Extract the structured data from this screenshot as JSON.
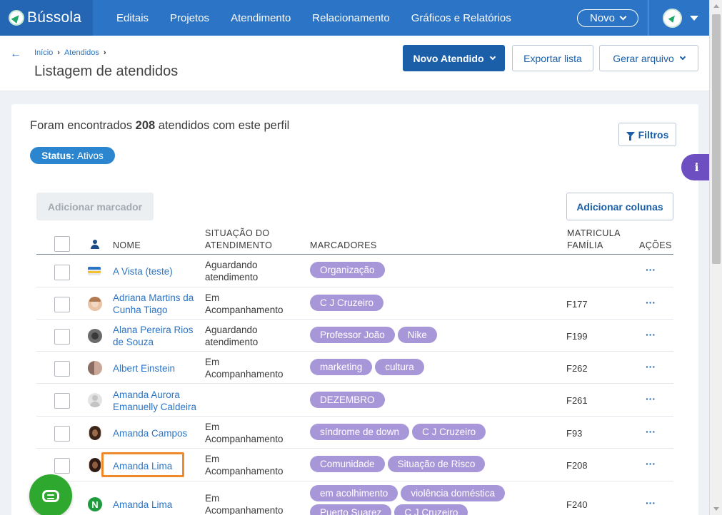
{
  "app": {
    "logo_text": "Bússola"
  },
  "nav": {
    "items": [
      "Editais",
      "Projetos",
      "Atendimento",
      "Relacionamento",
      "Gráficos e Relatórios"
    ],
    "novo_label": "Novo"
  },
  "header": {
    "breadcrumb": [
      "Início",
      "Atendidos"
    ],
    "title": "Listagem de atendidos",
    "btn_novo_atendido": "Novo Atendido",
    "btn_exportar": "Exportar lista",
    "btn_gerar": "Gerar arquivo"
  },
  "summary": {
    "prefix": "Foram encontrados",
    "count": "208",
    "suffix": "atendidos com este perfil"
  },
  "filters": {
    "btn_label": "Filtros",
    "status_key": "Status:",
    "status_value": "Ativos"
  },
  "info_label": "i",
  "actions": {
    "add_marker": "Adicionar marcador",
    "add_columns": "Adicionar colunas"
  },
  "table": {
    "headers": {
      "nome": "NOME",
      "situacao_1": "SITUAÇÃO DO",
      "situacao_2": "ATENDIMENTO",
      "marcadores": "MARCADORES",
      "matricula_1": "MATRICULA",
      "matricula_2": "FAMÍLIA",
      "acoes": "AÇÕES"
    },
    "rows": [
      {
        "name_1": "A Vista (teste)",
        "name_2": "",
        "situ_1": "Aguardando",
        "situ_2": "atendimento",
        "tags": [
          "Organização"
        ],
        "matricula": "",
        "actions": "···"
      },
      {
        "name_1": "Adriana Martins da",
        "name_2": "Cunha Tiago",
        "situ_1": "Em",
        "situ_2": "Acompanhamento",
        "tags": [
          "C J Cruzeiro"
        ],
        "matricula": "F177",
        "actions": "···"
      },
      {
        "name_1": "Alana Pereira Rios",
        "name_2": "de Souza",
        "situ_1": "Aguardando",
        "situ_2": "atendimento",
        "tags": [
          "Professor João",
          "Nike"
        ],
        "matricula": "F199",
        "actions": "···"
      },
      {
        "name_1": "Albert Einstein",
        "name_2": "",
        "situ_1": "Em",
        "situ_2": "Acompanhamento",
        "tags": [
          "marketing",
          "cultura"
        ],
        "matricula": "F262",
        "actions": "···"
      },
      {
        "name_1": "Amanda Aurora",
        "name_2": "Emanuelly Caldeira",
        "situ_1": "",
        "situ_2": "",
        "tags": [
          "DEZEMBRO"
        ],
        "matricula": "F261",
        "actions": "···"
      },
      {
        "name_1": "Amanda Campos",
        "name_2": "",
        "situ_1": "Em",
        "situ_2": "Acompanhamento",
        "tags": [
          "síndrome de down",
          "C J Cruzeiro"
        ],
        "matricula": "F93",
        "actions": "···"
      },
      {
        "name_1": "Amanda Lima",
        "name_2": "",
        "situ_1": "Em",
        "situ_2": "Acompanhamento",
        "tags": [
          "Comunidade",
          "Situação de Risco"
        ],
        "matricula": "F208",
        "actions": "···"
      },
      {
        "name_1": "Amanda Lima",
        "name_2": "",
        "situ_1": "Em",
        "situ_2": "Acompanhamento",
        "tags": [
          "em acolhimento",
          "violência doméstica",
          "Puerto Suarez",
          "C J Cruzeiro"
        ],
        "matricula": "F240",
        "actions": "···",
        "avatar_letter": "N"
      }
    ]
  },
  "colors": {
    "nav_bg": "#2b74c6",
    "primary": "#1a5fa8",
    "tag": "#a897d8",
    "highlight": "#f0892a",
    "chat": "#2ea82e"
  }
}
